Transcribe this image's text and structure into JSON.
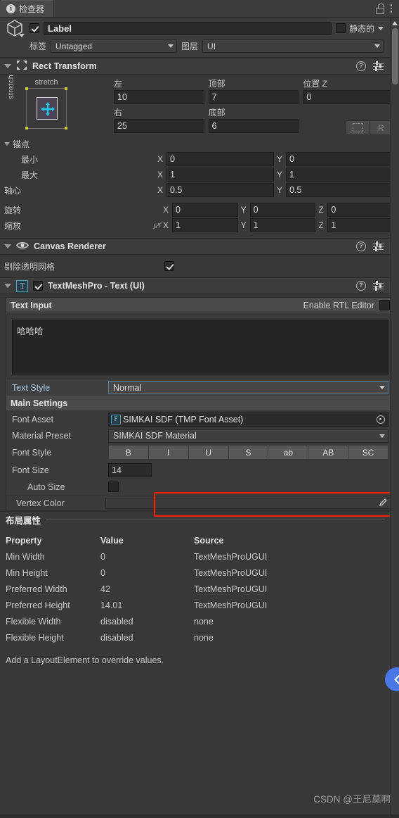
{
  "tab": {
    "title": "检查器",
    "info_icon": "info-icon",
    "lock_icon": "lock-icon",
    "menu_icon": "kebab-menu-icon"
  },
  "gameobject": {
    "icon": "cube-icon",
    "enabled": true,
    "name": "Label",
    "static_label": "静态的",
    "static_checked": false,
    "tag_label": "标签",
    "tag_value": "Untagged",
    "layer_label": "图层",
    "layer_value": "UI"
  },
  "rect_transform": {
    "title": "Rect Transform",
    "anchor_preset": {
      "horizontal": "stretch",
      "vertical": "stretch"
    },
    "left_label": "左",
    "left_value": "10",
    "top_label": "顶部",
    "top_value": "7",
    "posz_label": "位置 Z",
    "posz_value": "0",
    "right_label": "右",
    "right_value": "25",
    "bottom_label": "底部",
    "bottom_value": "6",
    "blueprint_button": "blueprint-mode",
    "raw_button": "R",
    "anchors_label": "锚点",
    "min_label": "最小",
    "min_x": "0",
    "min_y": "0",
    "max_label": "最大",
    "max_x": "1",
    "max_y": "1",
    "pivot_label": "轴心",
    "pivot_x": "0.5",
    "pivot_y": "0.5",
    "rotation_label": "旋转",
    "rot_x": "0",
    "rot_y": "0",
    "rot_z": "0",
    "scale_label": "缩放",
    "scale_x": "1",
    "scale_y": "1",
    "scale_z": "1",
    "axis_x": "X",
    "axis_y": "Y",
    "axis_z": "Z"
  },
  "canvas_renderer": {
    "title": "Canvas Renderer",
    "cull_label": "剔除透明网格",
    "cull_checked": true
  },
  "tmp": {
    "title": "TextMeshPro - Text (UI)",
    "enabled": true,
    "text_input_label": "Text Input",
    "rtl_label": "Enable RTL Editor",
    "rtl_checked": false,
    "text_value": "哈哈哈",
    "text_style_label": "Text Style",
    "text_style_value": "Normal",
    "main_settings_label": "Main Settings",
    "font_asset_label": "Font Asset",
    "font_asset_value": "SIMKAI SDF (TMP Font Asset)",
    "material_preset_label": "Material Preset",
    "material_preset_value": "SIMKAI SDF Material",
    "font_style_label": "Font Style",
    "font_style_buttons": [
      "B",
      "I",
      "U",
      "S",
      "ab",
      "AB",
      "SC"
    ],
    "font_size_label": "Font Size",
    "font_size_value": "14",
    "auto_size_label": "Auto Size",
    "auto_size_checked": false,
    "vertex_color_label": "Vertex Color"
  },
  "layout_properties": {
    "title": "布局属性",
    "headers": [
      "Property",
      "Value",
      "Source"
    ],
    "rows": [
      {
        "property": "Min Width",
        "value": "0",
        "source": "TextMeshProUGUI"
      },
      {
        "property": "Min Height",
        "value": "0",
        "source": "TextMeshProUGUI"
      },
      {
        "property": "Preferred Width",
        "value": "42",
        "source": "TextMeshProUGUI"
      },
      {
        "property": "Preferred Height",
        "value": "14.01",
        "source": "TextMeshProUGUI"
      },
      {
        "property": "Flexible Width",
        "value": "disabled",
        "source": "none"
      },
      {
        "property": "Flexible Height",
        "value": "disabled",
        "source": "none"
      }
    ],
    "note": "Add a LayoutElement to override values."
  },
  "watermark": "CSDN @王尼莫啊",
  "colors": {
    "panel_bg": "#383838",
    "header_bg": "#3c3c3c",
    "field_bg": "#2a2a2a",
    "accent_blue": "#4a77e8",
    "highlight_red": "#ff2200",
    "tmp_cyan": "#3fa9c9"
  }
}
